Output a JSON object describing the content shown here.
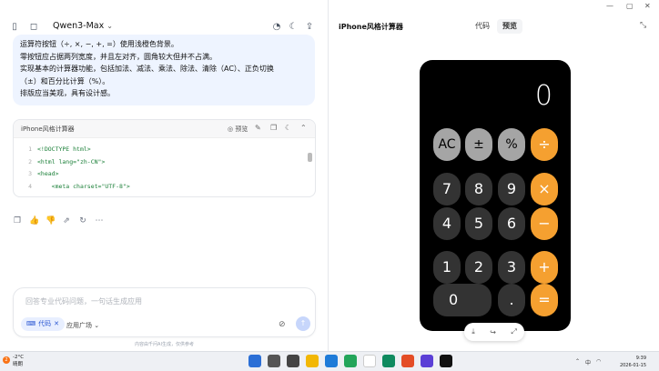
{
  "left": {
    "model_name": "Qwen3-Max",
    "prompt_lines": [
      "运算符按钮（÷, ×, −, +, =）使用浅橙色背景。",
      "零按钮应占据两列宽度，并且左对齐，圆角较大但并不占满。",
      "实现基本的计算器功能，包括加法、减法、乘法、除法、清除（AC）、正负切换",
      "（±）和百分比计算（%）。",
      "排版应当美观，具有设计感。"
    ],
    "code_card": {
      "title": "iPhone风格计算器",
      "preview_label": "预览",
      "lines": [
        {
          "n": "1",
          "t": "<!DOCTYPE html>"
        },
        {
          "n": "2",
          "t": "<html lang=\"zh-CN\">"
        },
        {
          "n": "3",
          "t": "<head>"
        },
        {
          "n": "4",
          "t": "    <meta charset=\"UTF-8\">"
        }
      ]
    },
    "input_placeholder": "回答专业代码问题，一句话生成应用",
    "chip_label": "代码",
    "app_square_label": "应用广场",
    "disclaimer": "内容由千问AI生成，仅供参考"
  },
  "right": {
    "title": "iPhone风格计算器",
    "tabs": [
      "代码",
      "预览"
    ],
    "active_tab": "预览",
    "calculator": {
      "display": "0",
      "rows": [
        [
          {
            "label": "AC",
            "kind": "fn"
          },
          {
            "label": "±",
            "kind": "fn"
          },
          {
            "label": "%",
            "kind": "fn"
          },
          {
            "label": "÷",
            "kind": "op"
          }
        ],
        [
          {
            "label": "7",
            "kind": "num"
          },
          {
            "label": "8",
            "kind": "num"
          },
          {
            "label": "9",
            "kind": "num"
          },
          {
            "label": "×",
            "kind": "op"
          }
        ],
        [
          {
            "label": "4",
            "kind": "num"
          },
          {
            "label": "5",
            "kind": "num"
          },
          {
            "label": "6",
            "kind": "num"
          },
          {
            "label": "−",
            "kind": "op"
          }
        ],
        [
          {
            "label": "1",
            "kind": "num"
          },
          {
            "label": "2",
            "kind": "num"
          },
          {
            "label": "3",
            "kind": "num"
          },
          {
            "label": "+",
            "kind": "op"
          }
        ],
        [
          {
            "label": "0",
            "kind": "zero"
          },
          {
            "label": ".",
            "kind": "num"
          },
          {
            "label": "=",
            "kind": "op"
          }
        ]
      ],
      "colors": {
        "fn": "#a5a5a5",
        "num": "#333333",
        "op": "#f5a030",
        "bg": "#000000"
      }
    }
  },
  "taskbar": {
    "weather_temp": "-2°C",
    "weather_desc": "晴朗",
    "time": "9:39",
    "date": "2026-01-15",
    "input_method": "中",
    "notification_badge": "2"
  }
}
